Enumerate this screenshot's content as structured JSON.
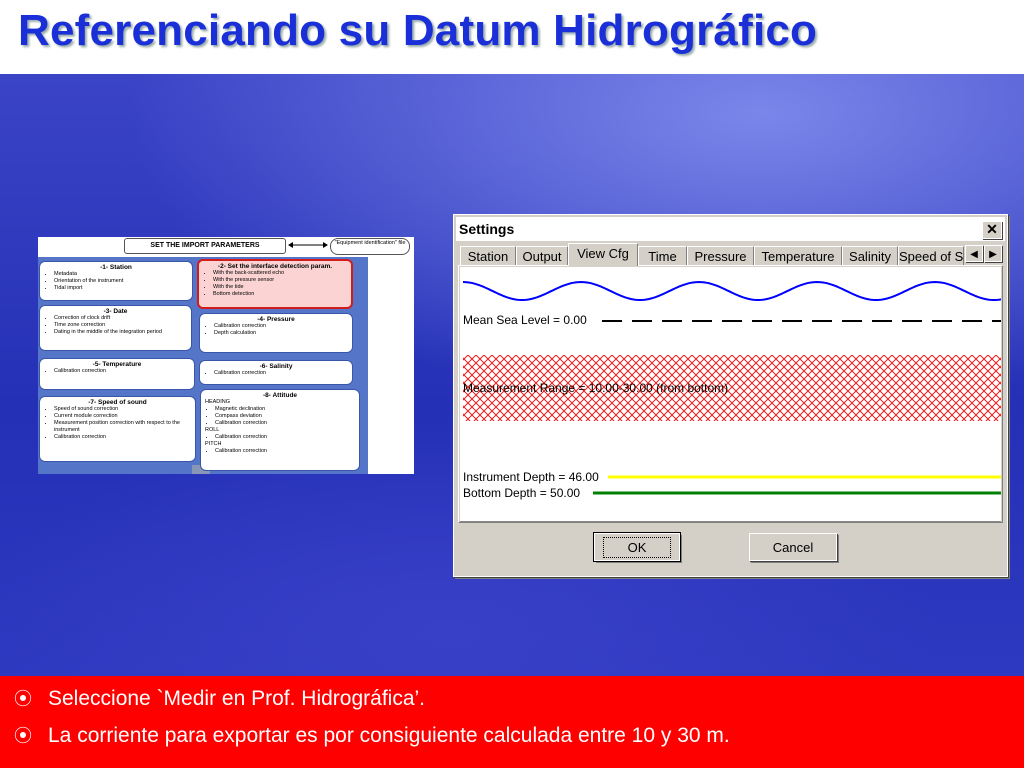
{
  "slide": {
    "title": "Referenciando su Datum Hidrográfico",
    "bullets": [
      "Seleccione `Medir en Prof. Hidrográfica’.",
      "La corriente para exportar es por consiguiente calculada entre 10 y 30 m."
    ],
    "bullet_icon": "radio-bullet-icon"
  },
  "diagram": {
    "header": "SET THE IMPORT PARAMETERS",
    "equipment_note": "\"Equipment identification\" file",
    "boxes": {
      "station": {
        "title": "-1- Station",
        "items": [
          "Metadata",
          "Orientation of the instrument",
          "Tidal import"
        ]
      },
      "interface": {
        "title": "-2- Set the interface detection param.",
        "items": [
          "With the back-scattered echo",
          "With the pressure sensor",
          "With the tide",
          "Bottom detection"
        ]
      },
      "date": {
        "title": "-3- Date",
        "items": [
          "Correction of clock drift",
          "Time zone correction",
          "Dating in the middle of the integration period"
        ]
      },
      "pressure": {
        "title": "-4- Pressure",
        "items": [
          "Calibration correction",
          "Depth calculation"
        ]
      },
      "temperature": {
        "title": "-5- Temperature",
        "items": [
          "Calibration correction"
        ]
      },
      "salinity": {
        "title": "-6- Salinity",
        "items": [
          "Calibration correction"
        ]
      },
      "sound": {
        "title": "-7- Speed of sound",
        "items": [
          "Speed of sound correction",
          "Current module correction",
          "Measurement position correction with respect to the instrument",
          "Calibration correction"
        ]
      },
      "attitude": {
        "title": "-8- Attitude",
        "heading_label": "HEADING",
        "heading_items": [
          "Magnetic declination",
          "Compass deviation",
          "Calibration correction"
        ],
        "roll_label": "ROLL",
        "roll_items": [
          "Calibration correction"
        ],
        "pitch_label": "PITCH",
        "pitch_items": [
          "Calibration correction"
        ]
      }
    }
  },
  "dialog": {
    "title": "Settings",
    "close_icon": "close-icon",
    "tabs": [
      "Station",
      "Output",
      "View Cfg",
      "Time",
      "Pressure",
      "Temperature",
      "Salinity",
      "Speed of S"
    ],
    "active_tab": "View Cfg",
    "view": {
      "mean_sea_level": "Mean Sea Level = 0.00",
      "measurement_range": "Measurement Range = 10.00-30.00 (from bottom)",
      "instrument_depth": "Instrument Depth = 46.00",
      "bottom_depth": "Bottom Depth = 50.00",
      "colors": {
        "wave": "#0000ff",
        "range": "#ff0000",
        "instrument": "#ffff00",
        "bottom": "#008000"
      }
    },
    "ok_label": "OK",
    "cancel_label": "Cancel"
  }
}
